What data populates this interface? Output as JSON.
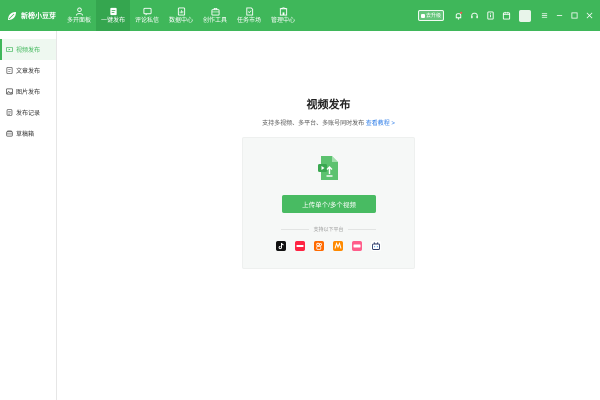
{
  "app": {
    "title": "新榜小豆芽"
  },
  "topnav": {
    "items": [
      {
        "label": "多开面板",
        "icon": "user-icon",
        "active": false
      },
      {
        "label": "一键发布",
        "icon": "publish-icon",
        "active": true
      },
      {
        "label": "评论私信",
        "icon": "message-icon",
        "active": false
      },
      {
        "label": "数据中心",
        "icon": "data-icon",
        "active": false
      },
      {
        "label": "创作工具",
        "icon": "toolbox-icon",
        "active": false
      },
      {
        "label": "任务市场",
        "icon": "task-icon",
        "active": false
      },
      {
        "label": "管理中心",
        "icon": "building-icon",
        "active": false
      }
    ]
  },
  "header_right": {
    "vip_label": "去升级",
    "icons": [
      "bell-icon",
      "headset-icon",
      "info-icon",
      "calendar-icon"
    ]
  },
  "window_controls": [
    "menu-icon",
    "minimize-icon",
    "maximize-icon",
    "close-icon"
  ],
  "sidebar": {
    "items": [
      {
        "label": "视频发布",
        "icon": "video-icon",
        "active": true
      },
      {
        "label": "文章发布",
        "icon": "article-icon",
        "active": false
      },
      {
        "label": "图片发布",
        "icon": "image-icon",
        "active": false
      },
      {
        "label": "发布记录",
        "icon": "record-icon",
        "active": false
      },
      {
        "label": "草稿箱",
        "icon": "drafts-icon",
        "active": false
      }
    ]
  },
  "main": {
    "title": "视频发布",
    "subtitle": "支持多视频、多平台、多账号同时发布",
    "tutorial_link": "查看教程 >",
    "upload_button": "上传单个/多个视频",
    "platform_caption": "支持以下平台",
    "platforms": [
      {
        "name": "douyin-icon",
        "color": "#111111"
      },
      {
        "name": "xiaohongshu-icon",
        "color": "#ff2442"
      },
      {
        "name": "kuaishou-icon",
        "color": "#ff6a00"
      },
      {
        "name": "orange-platform-icon",
        "color": "#ff8a00"
      },
      {
        "name": "pink-platform-icon",
        "color": "#ff5d8a"
      },
      {
        "name": "bilibili-icon",
        "color": "#2b3a67"
      }
    ]
  },
  "colors": {
    "brand_green": "#3fb75a",
    "button_green": "#48bb62",
    "link_blue": "#2e7de8"
  }
}
